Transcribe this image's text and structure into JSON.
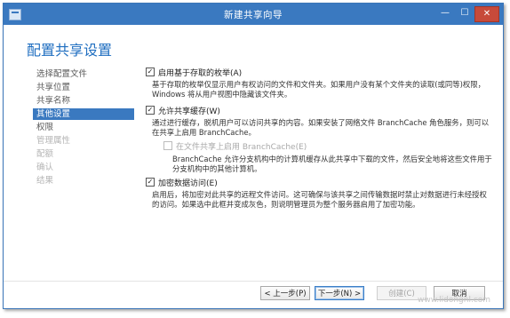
{
  "window": {
    "title": "新建共享向导",
    "minimize_glyph": "—",
    "maximize_glyph": "☐",
    "close_glyph": "✕"
  },
  "page": {
    "heading": "配置共享设置"
  },
  "nav": {
    "items": [
      {
        "label": "选择配置文件",
        "state": "normal"
      },
      {
        "label": "共享位置",
        "state": "normal"
      },
      {
        "label": "共享名称",
        "state": "normal"
      },
      {
        "label": "其他设置",
        "state": "active"
      },
      {
        "label": "权限",
        "state": "normal"
      },
      {
        "label": "管理属性",
        "state": "disabled"
      },
      {
        "label": "配额",
        "state": "disabled"
      },
      {
        "label": "确认",
        "state": "disabled"
      },
      {
        "label": "结果",
        "state": "disabled"
      }
    ]
  },
  "options": {
    "abe": {
      "label": "启用基于存取的枚举(A)",
      "checked": "✓",
      "desc": "基于存取的枚举仅显示用户有权访问的文件和文件夹。如果用户没有某个文件夹的读取(或同等)权限，Windows 将从用户视图中隐藏该文件夹。"
    },
    "cache": {
      "label": "允许共享缓存(W)",
      "checked": "✓",
      "desc": "通过进行缓存，脱机用户可以访问共享的内容。如果安装了网络文件 BranchCache 角色服务，则可以在共享上启用 BranchCache。"
    },
    "branchcache": {
      "label": "在文件共享上启用 BranchCache(E)",
      "checked": "",
      "desc": "BranchCache 允许分支机构中的计算机缓存从此共享中下载的文件，然后安全地将这些文件用于分支机构中的其他计算机。"
    },
    "encrypt": {
      "label": "加密数据访问(E)",
      "checked": "✓",
      "desc": "启用后，将加密对此共享的远程文件访问。这可确保与该共享之间传输数据时禁止对数据进行未经授权的访问。如果选中此框并变成灰色，则说明管理员为整个服务器启用了加密功能。"
    }
  },
  "buttons": {
    "prev": "< 上一步(P)",
    "next": "下一步(N) >",
    "create": "创建(C)",
    "cancel": "取消"
  },
  "watermark": "www.lidongnl.com",
  "colors": {
    "titlebar": "#3a79c0",
    "accent": "#1f6ec0",
    "active_nav": "#3a79c0",
    "close_button": "#c74a3a"
  }
}
